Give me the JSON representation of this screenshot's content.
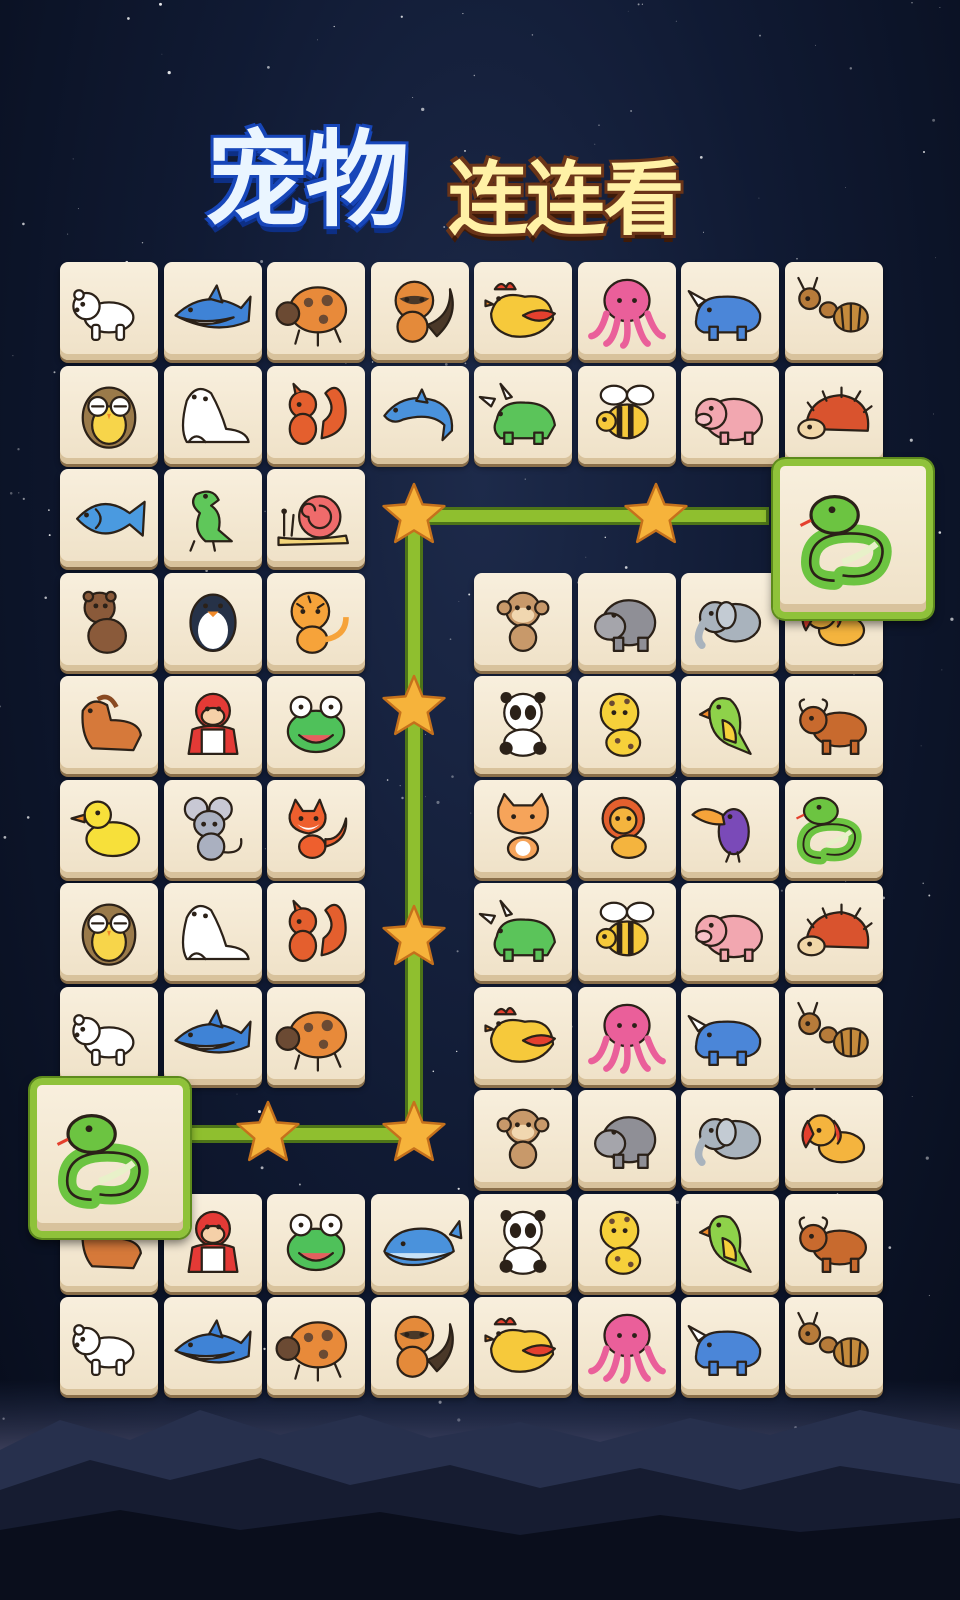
{
  "title": {
    "main": "宠物",
    "sub": "连连看"
  },
  "colors": {
    "path": "#8fbf2f",
    "star": "#f6b33b",
    "tile": "#f5ead5",
    "selected_border": "#8fc23a"
  },
  "grid": {
    "rows": [
      [
        "polar-bear",
        "shark",
        "ladybug",
        "raccoon",
        "rooster",
        "octopus",
        "rhino",
        "ant"
      ],
      [
        "owl",
        "seal",
        "squirrel",
        "dolphin",
        "triceratops",
        "bee",
        "pig",
        "hedgehog"
      ],
      [
        "fish",
        "dinosaur",
        "snail",
        null,
        null,
        null,
        null,
        "snake"
      ],
      [
        "bear",
        "penguin",
        "tiger",
        null,
        "monkey",
        "hippo",
        "elephant",
        "dog"
      ],
      [
        "horse",
        "gorilla",
        "frog",
        null,
        "panda",
        "leopard",
        "parrot",
        "ox"
      ],
      [
        "duck",
        "mouse",
        "fox",
        null,
        "cat",
        "lion",
        "toucan",
        "snake"
      ],
      [
        "owl",
        "seal",
        "squirrel",
        null,
        "triceratops",
        "bee",
        "pig",
        "hedgehog"
      ],
      [
        "polar-bear",
        "shark",
        "ladybug",
        null,
        "rooster",
        "octopus",
        "rhino",
        "ant"
      ],
      [
        "snake",
        null,
        null,
        null,
        "monkey",
        "hippo",
        "elephant",
        "dog"
      ],
      [
        "horse",
        "gorilla",
        "frog",
        "whale",
        "panda",
        "leopard",
        "parrot",
        "ox"
      ],
      [
        "polar-bear",
        "shark",
        "ladybug",
        "raccoon",
        "rooster",
        "octopus",
        "rhino",
        "ant"
      ]
    ]
  },
  "selected_pair": [
    {
      "row": 2,
      "col": 7,
      "animal": "snake"
    },
    {
      "row": 8,
      "col": 0,
      "animal": "snake"
    }
  ]
}
